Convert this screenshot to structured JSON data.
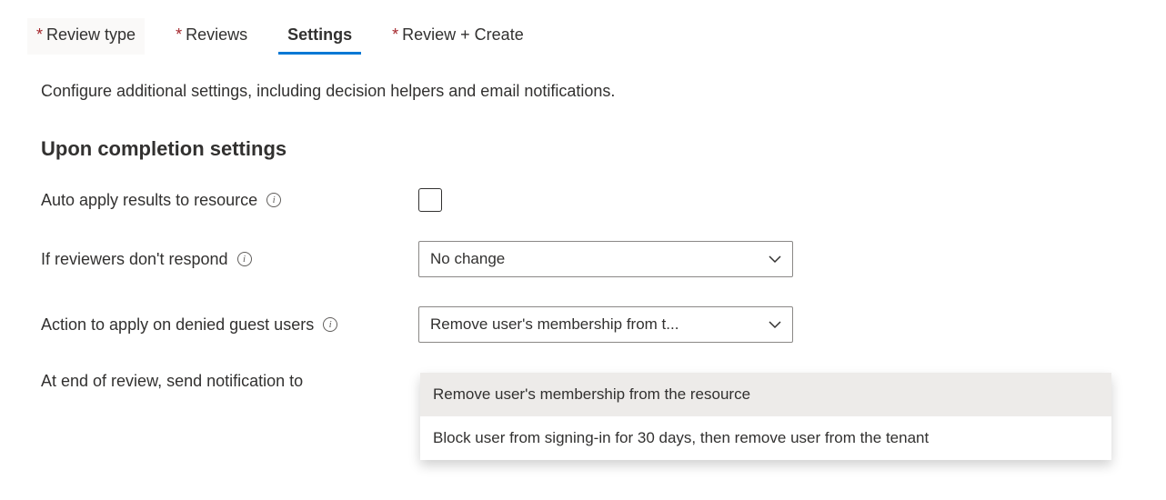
{
  "tabs": {
    "review_type": "Review type",
    "reviews": "Reviews",
    "settings": "Settings",
    "review_create": "Review + Create"
  },
  "description": "Configure additional settings, including decision helpers and email notifications.",
  "section_title": "Upon completion settings",
  "fields": {
    "auto_apply": {
      "label": "Auto apply results to resource"
    },
    "no_respond": {
      "label": "If reviewers don't respond",
      "value": "No change"
    },
    "denied_action": {
      "label": "Action to apply on denied guest users",
      "value": "Remove user's membership from t..."
    },
    "notification": {
      "label": "At end of review, send notification to"
    }
  },
  "dropdown_options": {
    "opt1": "Remove user's membership from the resource",
    "opt2": "Block user from signing-in for 30 days, then remove user from the tenant"
  }
}
